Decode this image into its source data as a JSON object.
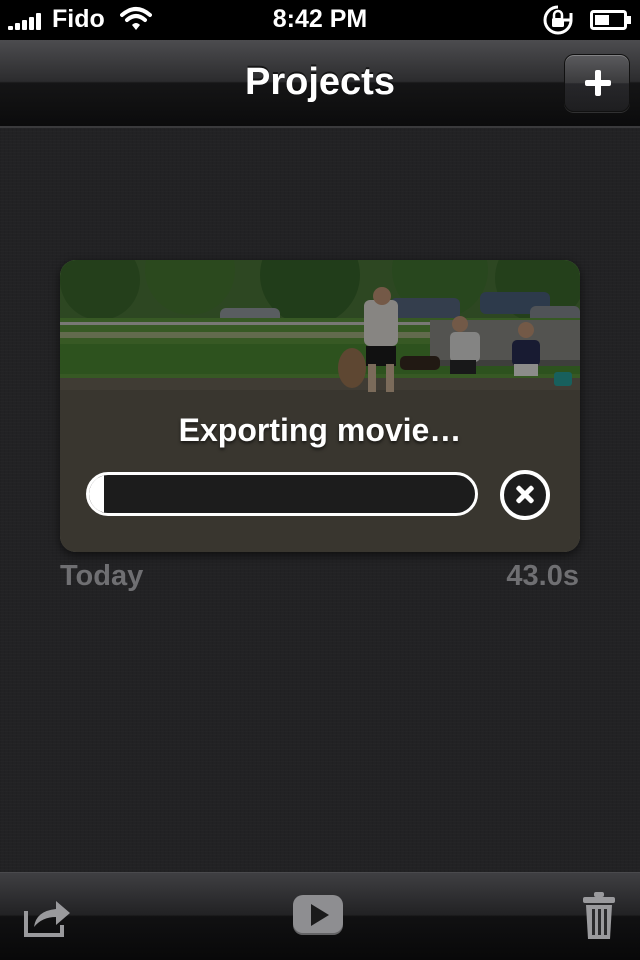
{
  "status_bar": {
    "carrier": "Fido",
    "time": "8:42 PM",
    "icons": [
      "signal-bars-icon",
      "wifi-icon",
      "rotation-lock-icon",
      "battery-icon"
    ]
  },
  "nav": {
    "title": "Projects",
    "add_icon": "plus-icon"
  },
  "project": {
    "status": "Exporting movie…",
    "progress_percent": 4,
    "date": "Today",
    "duration": "43.0s",
    "cancel_icon": "close-circle-icon"
  },
  "toolbar": {
    "icons": [
      "share-icon",
      "play-icon",
      "trash-icon"
    ]
  },
  "colors": {
    "background": "#222224",
    "secondary_text": "#6f6f72",
    "accent": "#ffffff"
  }
}
